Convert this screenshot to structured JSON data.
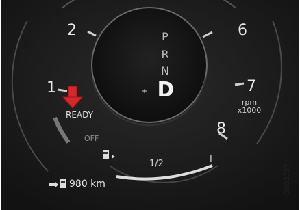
{
  "tachometer": {
    "labels": [
      "2",
      "1",
      "6",
      "7",
      "8"
    ],
    "unit_top": "rpm",
    "unit_bottom": "x1000"
  },
  "gear_selector": {
    "inactive": [
      "P",
      "R",
      "N"
    ],
    "active": "D",
    "plus_minus": "±"
  },
  "status": {
    "ready": "READY",
    "off": "OFF"
  },
  "fuel": {
    "half_label": "1/2",
    "full_mark": "I",
    "icon": "fuel-pump-icon"
  },
  "range": {
    "value": "980 km",
    "icon": "range-fuel-icon"
  },
  "image_code": "G052737",
  "colors": {
    "background": "#1a1a1a",
    "arrow": "#d62828",
    "needle_zone": "#7a7a7a"
  }
}
